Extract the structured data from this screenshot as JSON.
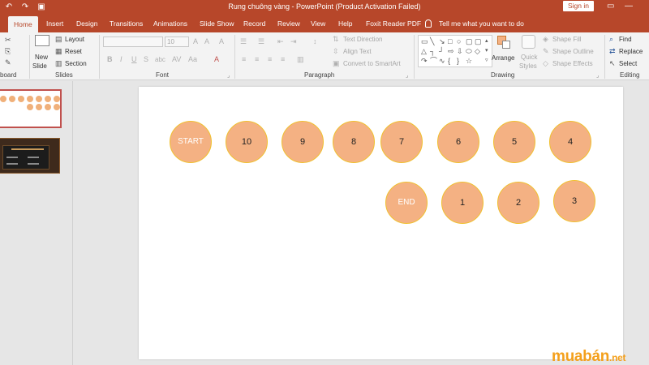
{
  "window": {
    "title": "Rung chuông vàng  -  PowerPoint (Product Activation Failed)",
    "signin": "Sign in"
  },
  "tabs": [
    "Home",
    "Insert",
    "Design",
    "Transitions",
    "Animations",
    "Slide Show",
    "Record",
    "Review",
    "View",
    "Help",
    "Foxit Reader PDF"
  ],
  "active_tab": "Home",
  "tell_me": "Tell me what you want to do",
  "ribbon": {
    "clipboard": {
      "label": "board"
    },
    "slides": {
      "label": "Slides",
      "new_slide_1": "New",
      "new_slide_2": "Slide",
      "layout": "Layout",
      "reset": "Reset",
      "section": "Section"
    },
    "font": {
      "label": "Font",
      "size": "10"
    },
    "paragraph": {
      "label": "Paragraph",
      "text_direction": "Text Direction",
      "align_text": "Align Text",
      "convert_smartart": "Convert to SmartArt"
    },
    "drawing": {
      "label": "Drawing",
      "arrange": "Arrange",
      "quick_styles_1": "Quick",
      "quick_styles_2": "Styles",
      "shape_fill": "Shape Fill",
      "shape_outline": "Shape Outline",
      "shape_effects": "Shape Effects"
    },
    "editing": {
      "label": "Editing",
      "find": "Find",
      "replace": "Replace",
      "select": "Select"
    }
  },
  "slide": {
    "row1": [
      "START",
      "10",
      "9",
      "8",
      "7",
      "6",
      "5",
      "4"
    ],
    "row2": [
      "END",
      "1",
      "2",
      "3"
    ]
  },
  "colors": {
    "titlebar": "#b7472a",
    "circle_fill": "#f4b183",
    "circle_border": "#f0c030"
  },
  "watermark": {
    "main": "muabán",
    "suffix": ".net"
  }
}
